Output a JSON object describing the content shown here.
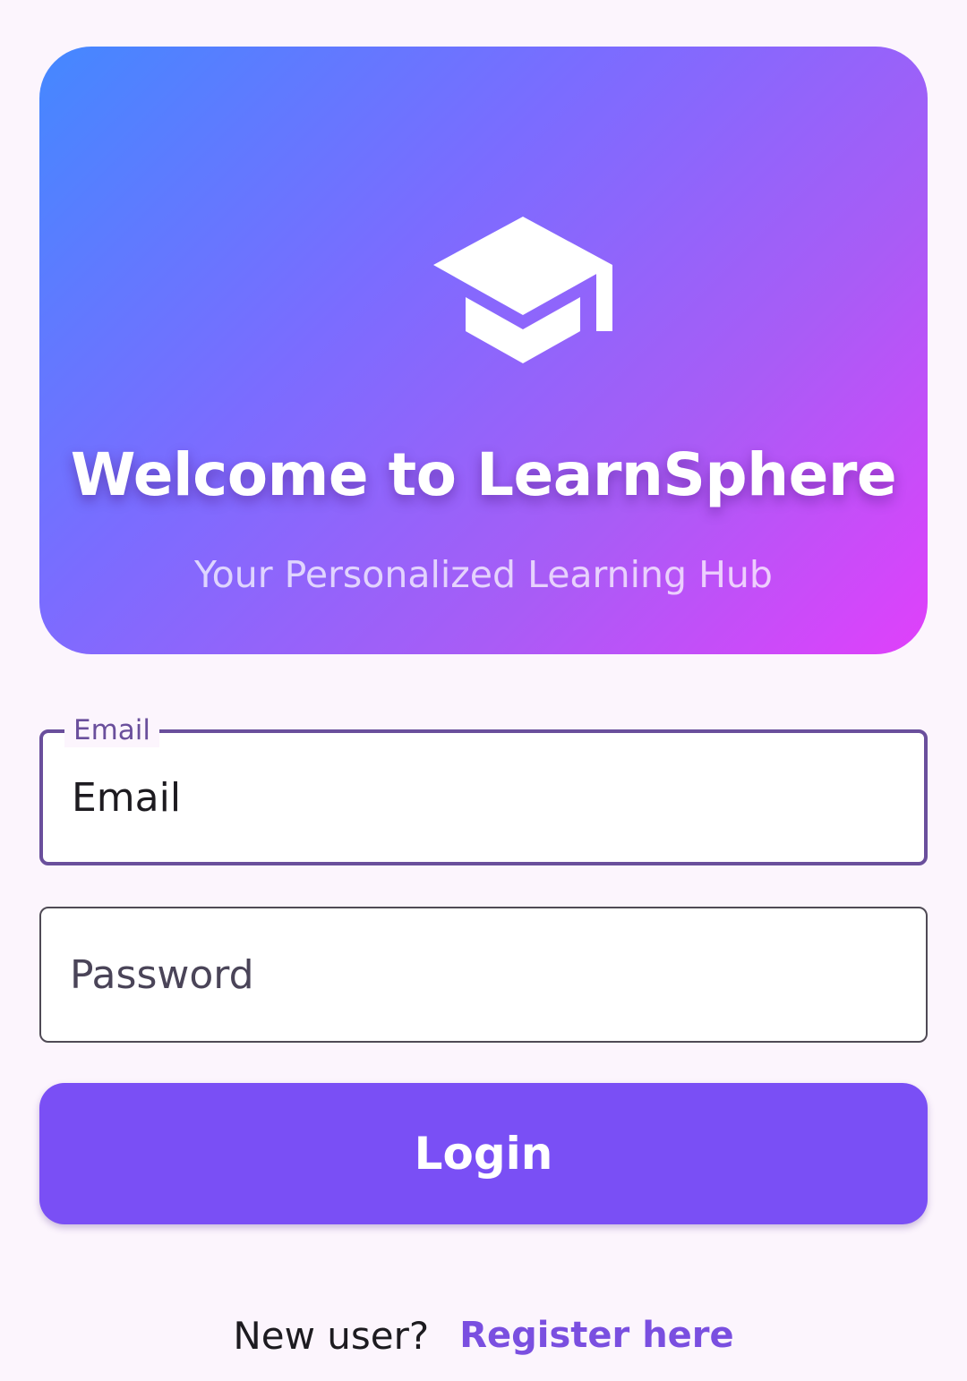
{
  "hero": {
    "icon": "graduation-cap-icon",
    "title": "Welcome to LearnSphere",
    "subtitle": "Your Personalized Learning Hub",
    "gradient_colors": [
      "#4488ff",
      "#7b6cff",
      "#a95cf6",
      "#e040fb"
    ]
  },
  "form": {
    "email": {
      "label": "Email",
      "value": "Email"
    },
    "password": {
      "placeholder": "Password"
    },
    "login_label": "Login"
  },
  "footer": {
    "prompt": "New user?",
    "register_label": "Register here"
  },
  "colors": {
    "background": "#fcf5fd",
    "primary": "#7a4ff5",
    "focused_outline": "#6a4f9c",
    "link": "#7a4fe0"
  }
}
